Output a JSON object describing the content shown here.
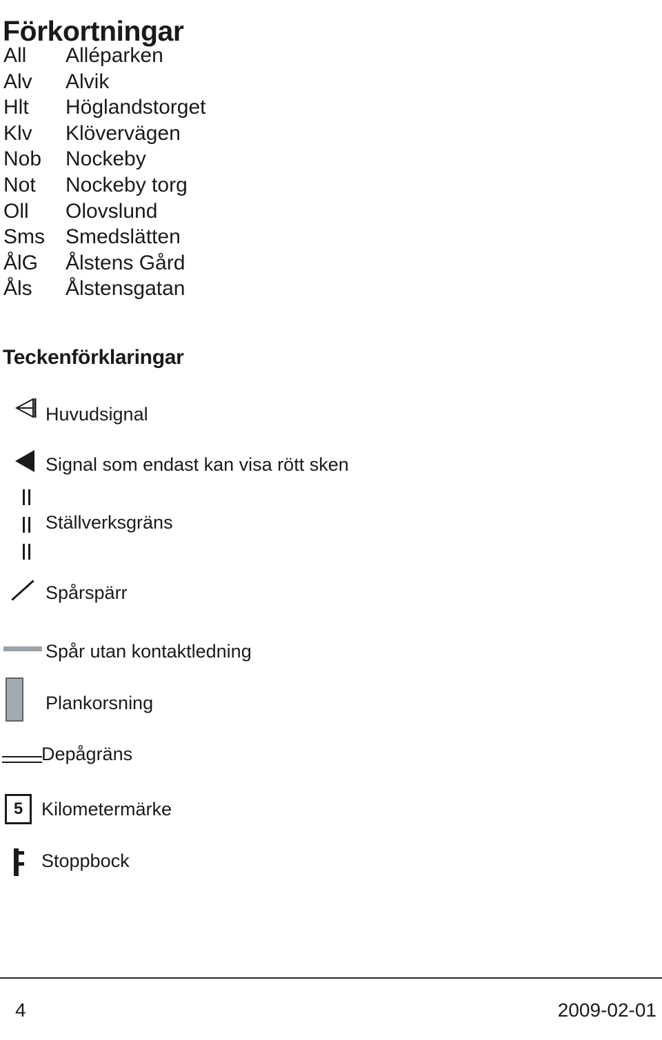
{
  "document": {
    "title": "Förkortningar",
    "legend_title": "Teckenförklaringar"
  },
  "abbreviations": {
    "rows": [
      {
        "code": "All",
        "name": "Alléparken"
      },
      {
        "code": "Alv",
        "name": "Alvik"
      },
      {
        "code": "Hlt",
        "name": "Höglandstorget"
      },
      {
        "code": "Klv",
        "name": "Klövervägen"
      },
      {
        "code": "Nob",
        "name": "Nockeby"
      },
      {
        "code": "Not",
        "name": "Nockeby torg"
      },
      {
        "code": "Oll",
        "name": "Olovslund"
      },
      {
        "code": "Sms",
        "name": "Smedslätten"
      },
      {
        "code": "ÅlG",
        "name": "Ålstens Gård"
      },
      {
        "code": "Åls",
        "name": "Ålstensgatan"
      }
    ]
  },
  "legend": {
    "items": [
      {
        "icon": "main-signal-icon",
        "label": "Huvudsignal"
      },
      {
        "icon": "red-only-signal-icon",
        "label": "Signal som endast kan visa rött sken"
      },
      {
        "icon": "interlocking-limit-icon",
        "label": "Ställverksgräns"
      },
      {
        "icon": "derailer-icon",
        "label": "Spårspärr"
      },
      {
        "icon": "track-without-catenary-icon",
        "label": "Spår utan kontaktledning"
      },
      {
        "icon": "level-crossing-icon",
        "label": "Plankorsning"
      },
      {
        "icon": "depot-limit-icon",
        "label": "Depågräns"
      },
      {
        "icon": "kilometre-marker-icon",
        "label": "Kilometermärke",
        "marker_value": "5"
      },
      {
        "icon": "buffer-stop-icon",
        "label": "Stoppbock"
      }
    ]
  },
  "footer": {
    "page_number": "4",
    "date": "2009-02-01"
  },
  "colors": {
    "text": "#1a1a1a",
    "catenary_line": "#9aa2a8",
    "level_crossing_fill": "#a3abb1",
    "level_crossing_border": "#5c6469",
    "rule": "#2a2a2a"
  }
}
